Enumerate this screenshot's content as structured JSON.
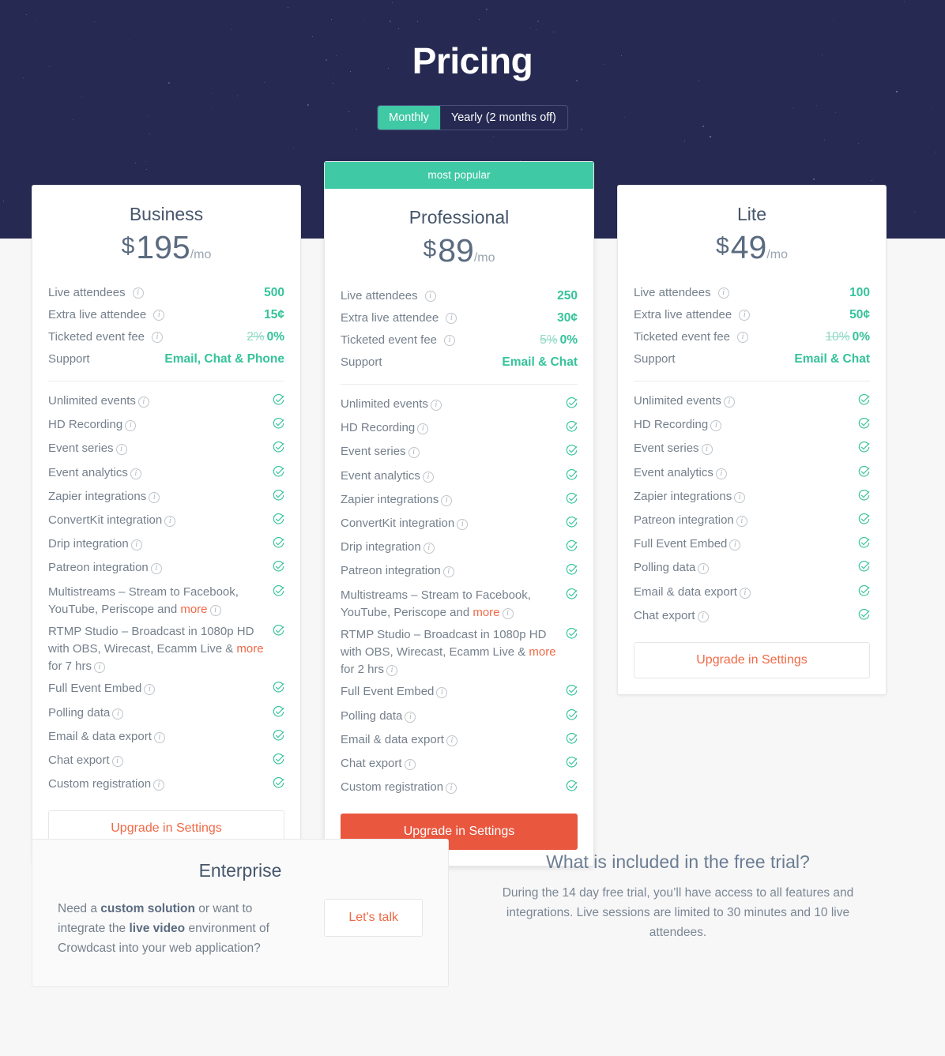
{
  "hero": {
    "title": "Pricing",
    "billing_toggle": {
      "options": [
        {
          "label": "Monthly",
          "active": true
        },
        {
          "label": "Yearly (2 months off)",
          "active": false
        }
      ]
    }
  },
  "colors": {
    "hero_background": "#262a52",
    "accent_teal": "#3fc9a5",
    "accent_orange": "#e9573f",
    "link_orange": "#ef6a47",
    "page_background": "#f7f7f8",
    "heading_slate": "#46566b",
    "body_gray": "#75808c"
  },
  "labels": {
    "popular_banner": "most popular",
    "upgrade_button": "Upgrade in Settings",
    "info_icon": "i",
    "check_icon": "check-circle"
  },
  "spec_labels": {
    "live_attendees": "Live attendees",
    "extra_live_attendee": "Extra live attendee",
    "ticketed_event_fee": "Ticketed event fee",
    "support": "Support"
  },
  "plans": [
    {
      "id": "business",
      "name": "Business",
      "popular": false,
      "currency": "$",
      "price": "195",
      "period": "/mo",
      "cta": "Upgrade in Settings",
      "cta_style": "outline",
      "specs": [
        {
          "label": "Live attendees",
          "value": "500",
          "old": ""
        },
        {
          "label": "Extra live attendee",
          "value": "15¢",
          "old": ""
        },
        {
          "label": "Ticketed event fee",
          "value": "0%",
          "old": "2%"
        },
        {
          "label": "Support",
          "value": "Email, Chat & Phone",
          "old": ""
        }
      ],
      "features": [
        {
          "text": "Unlimited events",
          "more": "",
          "tail": "",
          "included": true
        },
        {
          "text": "HD Recording",
          "more": "",
          "tail": "",
          "included": true
        },
        {
          "text": "Event series",
          "more": "",
          "tail": "",
          "included": true
        },
        {
          "text": "Event analytics",
          "more": "",
          "tail": "",
          "included": true
        },
        {
          "text": "Zapier integrations",
          "more": "",
          "tail": "",
          "included": true
        },
        {
          "text": "ConvertKit integration",
          "more": "",
          "tail": "",
          "included": true
        },
        {
          "text": "Drip integration",
          "more": "",
          "tail": "",
          "included": true
        },
        {
          "text": "Patreon integration",
          "more": "",
          "tail": "",
          "included": true
        },
        {
          "text": "Multistreams – Stream to Facebook, YouTube, Periscope and ",
          "more": "more",
          "tail": "",
          "included": true
        },
        {
          "text": "RTMP Studio – Broadcast in 1080p HD with OBS, Wirecast, Ecamm Live & ",
          "more": "more",
          "tail": " for 7 hrs",
          "included": true
        },
        {
          "text": "Full Event Embed",
          "more": "",
          "tail": "",
          "included": true
        },
        {
          "text": "Polling data",
          "more": "",
          "tail": "",
          "included": true
        },
        {
          "text": "Email & data export",
          "more": "",
          "tail": "",
          "included": true
        },
        {
          "text": "Chat export",
          "more": "",
          "tail": "",
          "included": true
        },
        {
          "text": "Custom registration",
          "more": "",
          "tail": "",
          "included": true
        }
      ]
    },
    {
      "id": "professional",
      "name": "Professional",
      "popular": true,
      "popular_label": "most popular",
      "currency": "$",
      "price": "89",
      "period": "/mo",
      "cta": "Upgrade in Settings",
      "cta_style": "primary",
      "specs": [
        {
          "label": "Live attendees",
          "value": "250",
          "old": ""
        },
        {
          "label": "Extra live attendee",
          "value": "30¢",
          "old": ""
        },
        {
          "label": "Ticketed event fee",
          "value": "0%",
          "old": "5%"
        },
        {
          "label": "Support",
          "value": "Email & Chat",
          "old": ""
        }
      ],
      "features": [
        {
          "text": "Unlimited events",
          "more": "",
          "tail": "",
          "included": true
        },
        {
          "text": "HD Recording",
          "more": "",
          "tail": "",
          "included": true
        },
        {
          "text": "Event series",
          "more": "",
          "tail": "",
          "included": true
        },
        {
          "text": "Event analytics",
          "more": "",
          "tail": "",
          "included": true
        },
        {
          "text": "Zapier integrations",
          "more": "",
          "tail": "",
          "included": true
        },
        {
          "text": "ConvertKit integration",
          "more": "",
          "tail": "",
          "included": true
        },
        {
          "text": "Drip integration",
          "more": "",
          "tail": "",
          "included": true
        },
        {
          "text": "Patreon integration",
          "more": "",
          "tail": "",
          "included": true
        },
        {
          "text": "Multistreams – Stream to Facebook, YouTube, Periscope and ",
          "more": "more",
          "tail": "",
          "included": true
        },
        {
          "text": "RTMP Studio – Broadcast in 1080p HD with OBS, Wirecast, Ecamm Live & ",
          "more": "more",
          "tail": " for 2 hrs",
          "included": true
        },
        {
          "text": "Full Event Embed",
          "more": "",
          "tail": "",
          "included": true
        },
        {
          "text": "Polling data",
          "more": "",
          "tail": "",
          "included": true
        },
        {
          "text": "Email & data export",
          "more": "",
          "tail": "",
          "included": true
        },
        {
          "text": "Chat export",
          "more": "",
          "tail": "",
          "included": true
        },
        {
          "text": "Custom registration",
          "more": "",
          "tail": "",
          "included": true
        }
      ]
    },
    {
      "id": "lite",
      "name": "Lite",
      "popular": false,
      "currency": "$",
      "price": "49",
      "period": "/mo",
      "cta": "Upgrade in Settings",
      "cta_style": "outline",
      "specs": [
        {
          "label": "Live attendees",
          "value": "100",
          "old": ""
        },
        {
          "label": "Extra live attendee",
          "value": "50¢",
          "old": ""
        },
        {
          "label": "Ticketed event fee",
          "value": "0%",
          "old": "10%"
        },
        {
          "label": "Support",
          "value": "Email & Chat",
          "old": ""
        }
      ],
      "features": [
        {
          "text": "Unlimited events",
          "more": "",
          "tail": "",
          "included": true
        },
        {
          "text": "HD Recording",
          "more": "",
          "tail": "",
          "included": true
        },
        {
          "text": "Event series",
          "more": "",
          "tail": "",
          "included": true
        },
        {
          "text": "Event analytics",
          "more": "",
          "tail": "",
          "included": true
        },
        {
          "text": "Zapier integrations",
          "more": "",
          "tail": "",
          "included": true
        },
        {
          "text": "Patreon integration",
          "more": "",
          "tail": "",
          "included": true
        },
        {
          "text": "Full Event Embed",
          "more": "",
          "tail": "",
          "included": true
        },
        {
          "text": "Polling data",
          "more": "",
          "tail": "",
          "included": true
        },
        {
          "text": "Email & data export",
          "more": "",
          "tail": "",
          "included": true
        },
        {
          "text": "Chat export",
          "more": "",
          "tail": "",
          "included": true
        }
      ]
    }
  ],
  "enterprise": {
    "title": "Enterprise",
    "description_parts": [
      {
        "text": "Need a ",
        "bold": false
      },
      {
        "text": "custom solution",
        "bold": true
      },
      {
        "text": " or want to integrate the ",
        "bold": false
      },
      {
        "text": "live video",
        "bold": true
      },
      {
        "text": " environment of Crowdcast into your web application?",
        "bold": false
      }
    ],
    "button": "Let's talk"
  },
  "trial": {
    "title": "What is included in the free trial?",
    "text": "During the 14 day free trial, you’ll have access to all features and integrations. Live sessions are limited to 30 minutes and 10 live attendees."
  }
}
